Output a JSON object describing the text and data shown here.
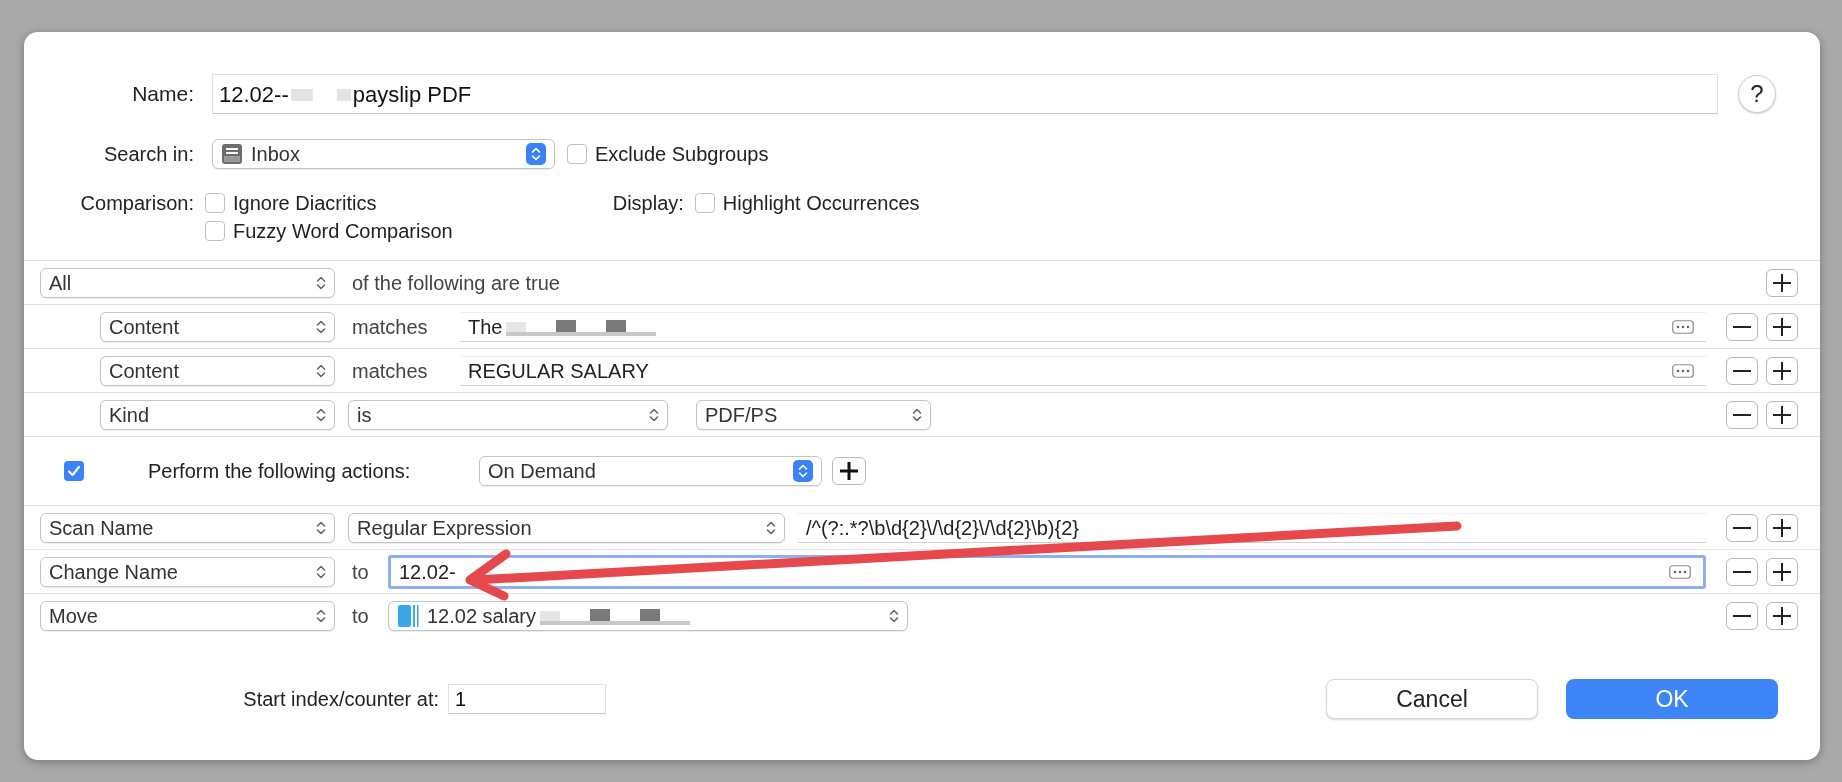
{
  "name": {
    "label": "Name:",
    "value_start": "12.02--",
    "value_end": "payslip PDF",
    "redacted": true
  },
  "help_button": {
    "label": "?"
  },
  "search_in": {
    "label": "Search in:",
    "value": "Inbox"
  },
  "exclude_subgroups": {
    "label": "Exclude Subgroups",
    "checked": false
  },
  "comparison": {
    "label": "Comparison:",
    "options": [
      {
        "label": "Ignore Diacritics",
        "checked": false
      },
      {
        "label": "Fuzzy Word Comparison",
        "checked": false
      }
    ]
  },
  "display": {
    "label": "Display:",
    "options": [
      {
        "label": "Highlight Occurrences",
        "checked": false
      }
    ]
  },
  "conditions": {
    "match": "All",
    "suffix": "of the following are true",
    "rows": [
      {
        "kind": "text",
        "field": "Content",
        "operator": "matches",
        "value": "The",
        "redacted": true
      },
      {
        "kind": "text",
        "field": "Content",
        "operator": "matches",
        "value": "REGULAR SALARY",
        "redacted": false
      },
      {
        "kind": "popup",
        "field": "Kind",
        "operator": "is",
        "value": "PDF/PS"
      }
    ]
  },
  "actions": {
    "enabled": true,
    "label": "Perform the following actions:",
    "trigger": "On Demand",
    "rows": [
      {
        "kind": "regex",
        "action": "Scan Name",
        "mode": "Regular Expression",
        "value": "/^(?:.*?\\b\\d{2}\\/\\d{2}\\/\\d{2}\\b){2}"
      },
      {
        "kind": "text",
        "action": "Change Name",
        "connector": "to",
        "value": "12.02-",
        "focused": true
      },
      {
        "kind": "folder",
        "action": "Move",
        "connector": "to",
        "value": "12.02 salary",
        "redacted": true
      }
    ]
  },
  "start_index": {
    "label": "Start index/counter at:",
    "value": "1"
  },
  "buttons": [
    {
      "label": "Cancel",
      "default": false
    },
    {
      "label": "OK",
      "default": true
    }
  ]
}
